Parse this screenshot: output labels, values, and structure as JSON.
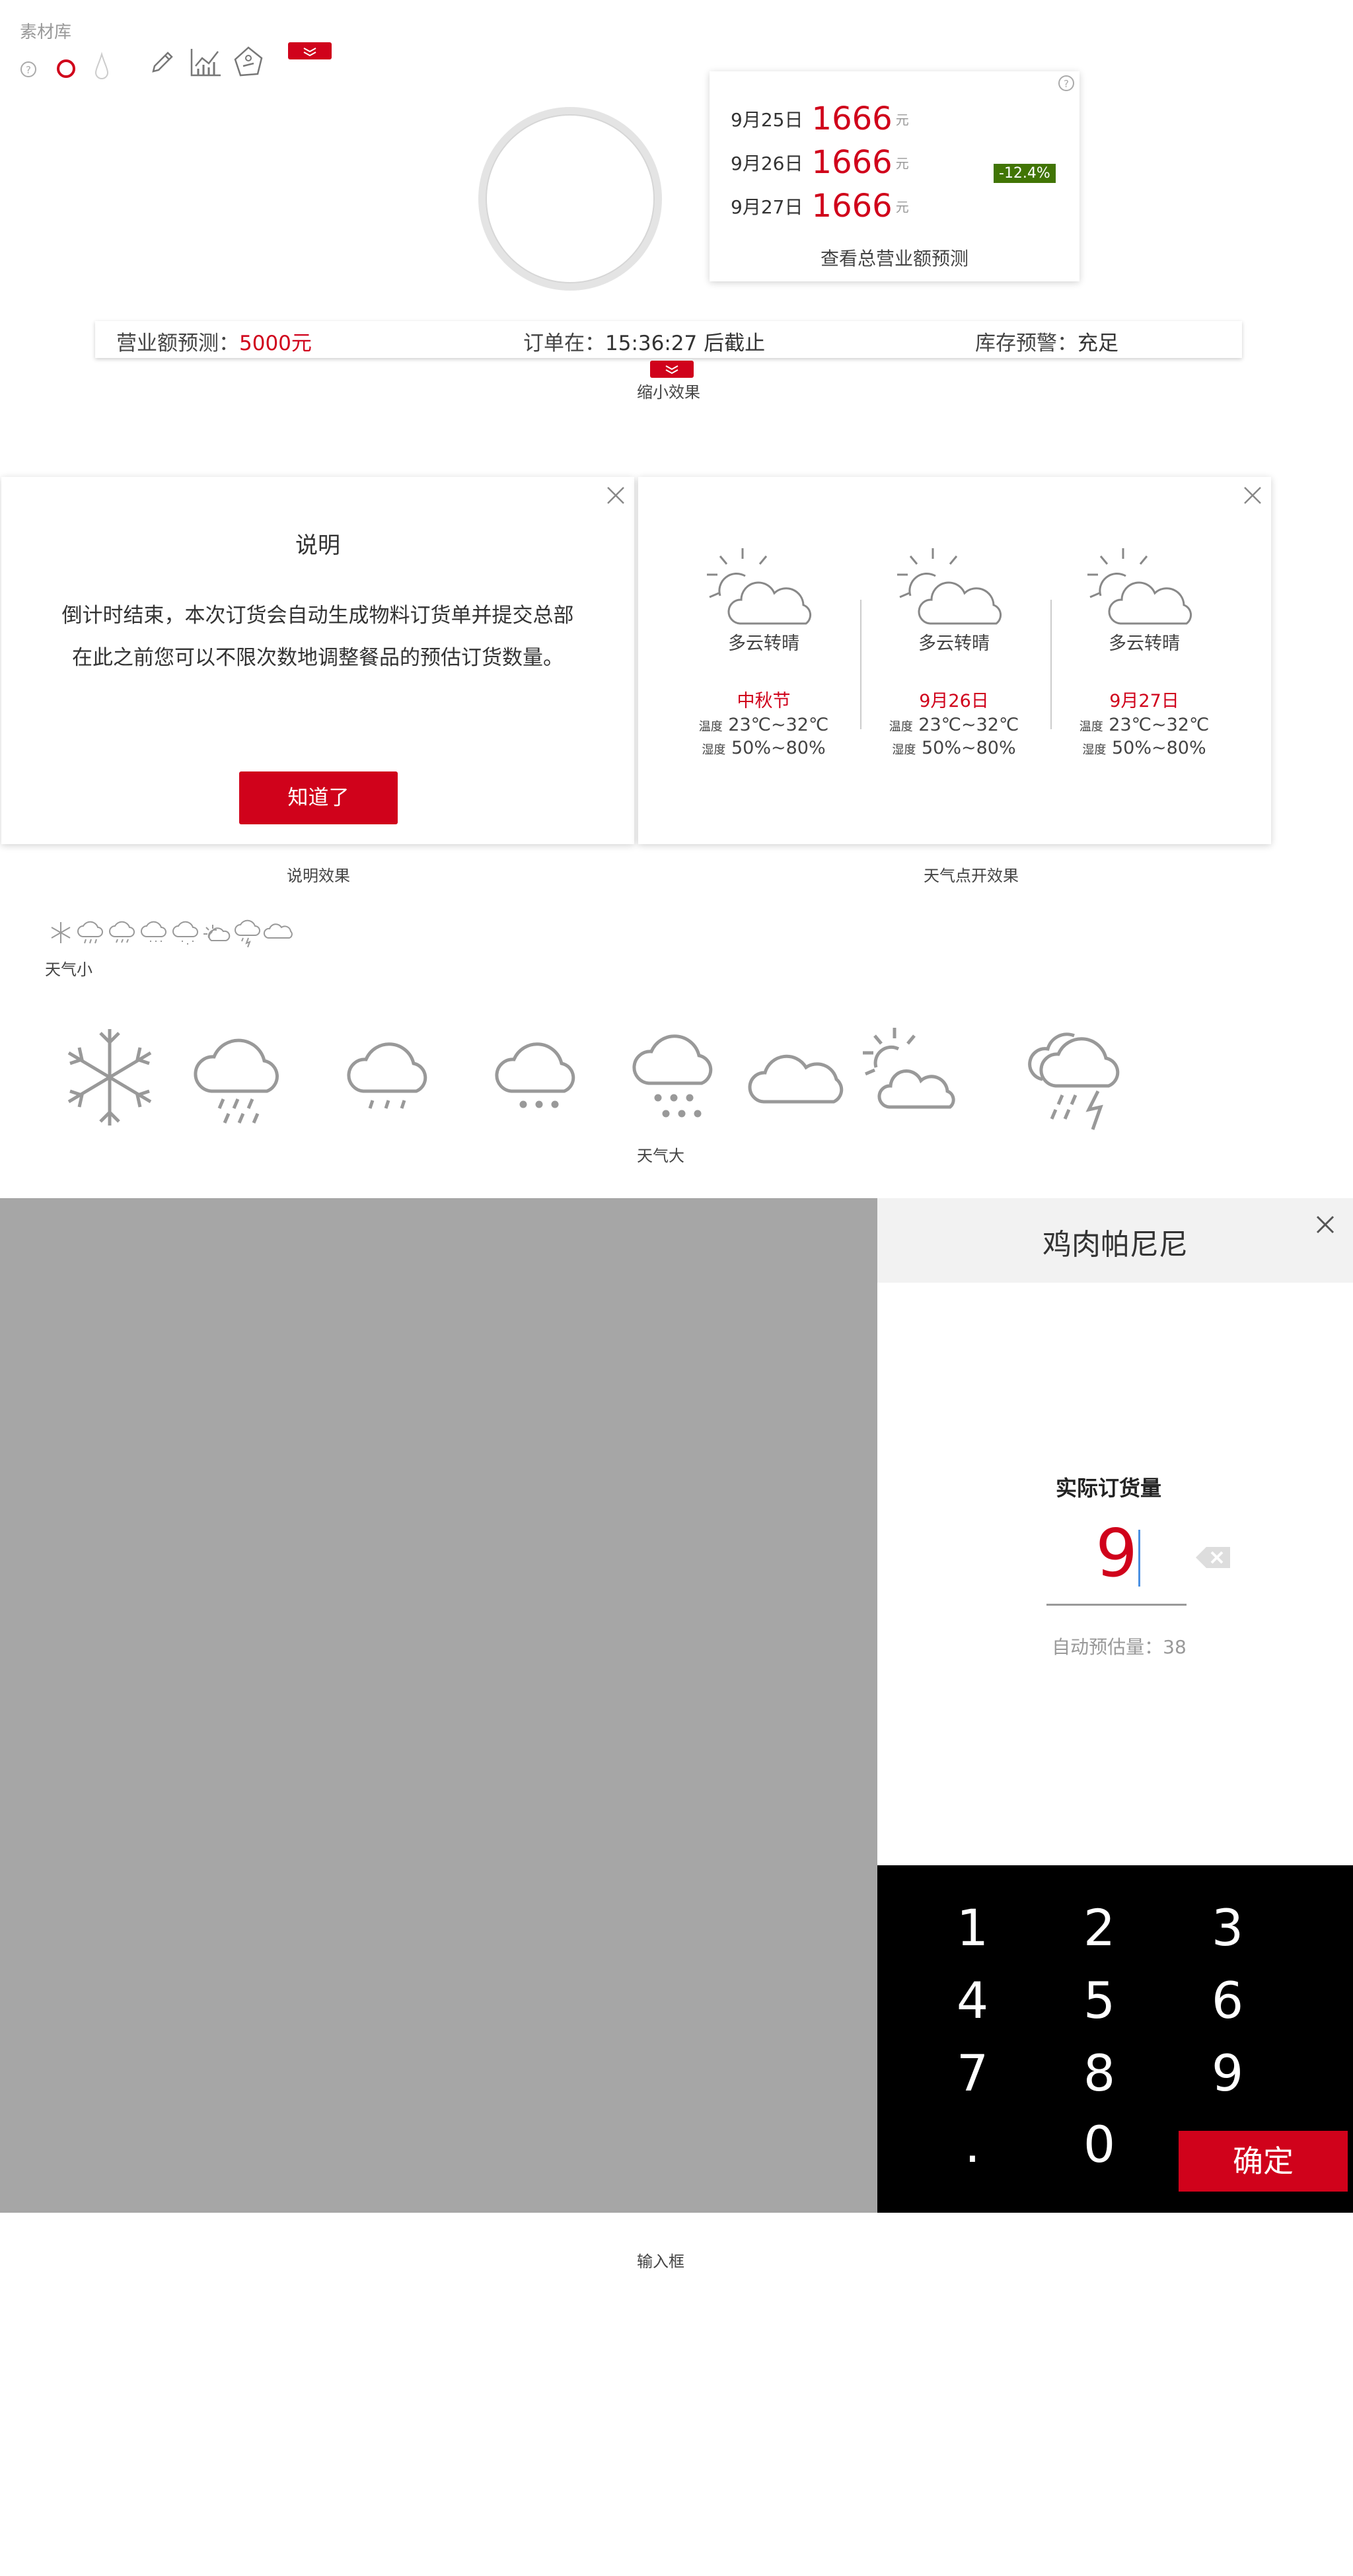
{
  "library": {
    "title": "素材库"
  },
  "forecast_card": {
    "rows": [
      {
        "date": "9月25日",
        "value": "1666",
        "unit": "元"
      },
      {
        "date": "9月26日",
        "value": "1666",
        "unit": "元"
      },
      {
        "date": "9月27日",
        "value": "1666",
        "unit": "元"
      }
    ],
    "change_badge": "-12.4%",
    "link": "查看总营业额预测",
    "help_icon": "?"
  },
  "status_bar": {
    "forecast_label": "营业额预测：",
    "forecast_value": "5000元",
    "order_label": "订单在：",
    "order_value": "15:36:27 后截止",
    "stock_label": "库存预警：",
    "stock_value": "充足",
    "caption": "缩小效果"
  },
  "explain_modal": {
    "title": "说明",
    "line1": "倒计时结束，本次订货会自动生成物料订货单并提交总部",
    "line2": "在此之前您可以不限次数地调整餐品的预估订货数量。",
    "button": "知道了",
    "caption": "说明效果"
  },
  "weather_modal": {
    "days": [
      {
        "condition": "多云转晴",
        "date": "中秋节",
        "temp_label": "温度",
        "temp": "23℃~32℃",
        "humid_label": "湿度",
        "humid": "50%~80%"
      },
      {
        "condition": "多云转晴",
        "date": "9月26日",
        "temp_label": "温度",
        "temp": "23℃~32℃",
        "humid_label": "湿度",
        "humid": "50%~80%"
      },
      {
        "condition": "多云转晴",
        "date": "9月27日",
        "temp_label": "温度",
        "temp": "23℃~32℃",
        "humid_label": "湿度",
        "humid": "50%~80%"
      }
    ],
    "caption": "天气点开效果"
  },
  "weather_small": {
    "caption": "天气小"
  },
  "weather_large": {
    "caption": "天气大"
  },
  "order_panel": {
    "title": "鸡肉帕尼尼",
    "label": "实际订货量",
    "value": "9",
    "estimate": "自动预估量：38",
    "keys": [
      "1",
      "2",
      "3",
      "4",
      "5",
      "6",
      "7",
      "8",
      "9",
      ".",
      "0"
    ],
    "confirm": "确定",
    "caption": "输入框"
  },
  "colors": {
    "accent": "#d0021b",
    "badge": "#417505",
    "overlay": "#a6a6a6",
    "keypad": "#000000"
  }
}
